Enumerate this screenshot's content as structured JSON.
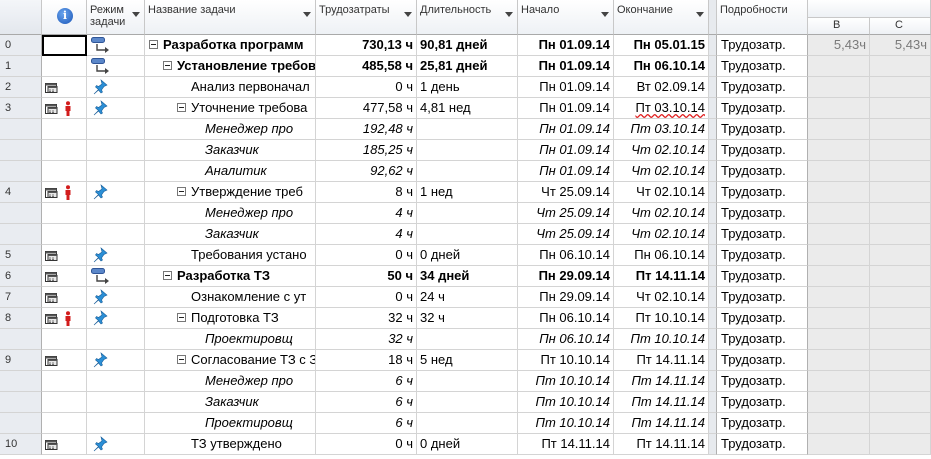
{
  "header": {
    "id": "",
    "indicators_icon": "info-icon",
    "mode": "Режим задачи",
    "name": "Название задачи",
    "work": "Трудозатраты",
    "duration": "Длительность",
    "start": "Начало",
    "finish": "Окончание",
    "details": "Подробности",
    "col_b": "B",
    "col_c": "C"
  },
  "rows": [
    {
      "id": "0",
      "ind": [],
      "mode": "auto",
      "name": "Разработка программ",
      "indent": 0,
      "toggle": true,
      "style": "bold",
      "work": "730,13 ч",
      "dur": "90,81 дней",
      "start": "Пн 01.09.14",
      "finish": "Пн 05.01.15",
      "det": "Трудозатр.",
      "b": "5,43ч",
      "cc": "5,43ч",
      "selected": true
    },
    {
      "id": "1",
      "ind": [],
      "mode": "auto",
      "name": "Установление требов",
      "indent": 1,
      "toggle": true,
      "style": "bold",
      "work": "485,58 ч",
      "dur": "25,81 дней",
      "start": "Пн 01.09.14",
      "finish": "Пн 06.10.14",
      "det": "Трудозатр.",
      "b": "",
      "cc": ""
    },
    {
      "id": "2",
      "ind": [
        "cal"
      ],
      "mode": "pin",
      "name": "Анализ первоначал",
      "indent": 3,
      "toggle": false,
      "style": "",
      "work": "0 ч",
      "dur": "1 день",
      "start": "Пн 01.09.14",
      "finish": "Вт 02.09.14",
      "det": "Трудозатр.",
      "b": "",
      "cc": ""
    },
    {
      "id": "3",
      "ind": [
        "cal",
        "res"
      ],
      "mode": "pin",
      "name": "Уточнение требова",
      "indent": 2,
      "toggle": true,
      "style": "",
      "work": "477,58 ч",
      "dur": "4,81 нед",
      "start": "Пн 01.09.14",
      "finish": "Пт 03.10.14",
      "det": "Трудозатр.",
      "b": "",
      "cc": "",
      "spell": true
    },
    {
      "id": "",
      "ind": [],
      "mode": "",
      "name": "Менеджер про",
      "indent": 4,
      "toggle": false,
      "style": "ital",
      "work": "192,48 ч",
      "dur": "",
      "start": "Пн 01.09.14",
      "finish": "Пт 03.10.14",
      "det": "Трудозатр.",
      "b": "",
      "cc": ""
    },
    {
      "id": "",
      "ind": [],
      "mode": "",
      "name": "Заказчик",
      "indent": 4,
      "toggle": false,
      "style": "ital",
      "work": "185,25 ч",
      "dur": "",
      "start": "Пн 01.09.14",
      "finish": "Чт 02.10.14",
      "det": "Трудозатр.",
      "b": "",
      "cc": ""
    },
    {
      "id": "",
      "ind": [],
      "mode": "",
      "name": "Аналитик",
      "indent": 4,
      "toggle": false,
      "style": "ital",
      "work": "92,62 ч",
      "dur": "",
      "start": "Пн 01.09.14",
      "finish": "Чт 02.10.14",
      "det": "Трудозатр.",
      "b": "",
      "cc": ""
    },
    {
      "id": "4",
      "ind": [
        "cal",
        "res"
      ],
      "mode": "pin",
      "name": "Утверждение треб",
      "indent": 2,
      "toggle": true,
      "style": "",
      "work": "8 ч",
      "dur": "1 нед",
      "start": "Чт 25.09.14",
      "finish": "Чт 02.10.14",
      "det": "Трудозатр.",
      "b": "",
      "cc": ""
    },
    {
      "id": "",
      "ind": [],
      "mode": "",
      "name": "Менеджер про",
      "indent": 4,
      "toggle": false,
      "style": "ital",
      "work": "4 ч",
      "dur": "",
      "start": "Чт 25.09.14",
      "finish": "Чт 02.10.14",
      "det": "Трудозатр.",
      "b": "",
      "cc": ""
    },
    {
      "id": "",
      "ind": [],
      "mode": "",
      "name": "Заказчик",
      "indent": 4,
      "toggle": false,
      "style": "ital",
      "work": "4 ч",
      "dur": "",
      "start": "Чт 25.09.14",
      "finish": "Чт 02.10.14",
      "det": "Трудозатр.",
      "b": "",
      "cc": ""
    },
    {
      "id": "5",
      "ind": [
        "cal"
      ],
      "mode": "pin",
      "name": "Требования устано",
      "indent": 3,
      "toggle": false,
      "style": "",
      "work": "0 ч",
      "dur": "0 дней",
      "start": "Пн 06.10.14",
      "finish": "Пн 06.10.14",
      "det": "Трудозатр.",
      "b": "",
      "cc": ""
    },
    {
      "id": "6",
      "ind": [
        "cal"
      ],
      "mode": "auto",
      "name": "Разработка ТЗ",
      "indent": 1,
      "toggle": true,
      "style": "bold",
      "work": "50 ч",
      "dur": "34 дней",
      "start": "Пн 29.09.14",
      "finish": "Пт 14.11.14",
      "det": "Трудозатр.",
      "b": "",
      "cc": ""
    },
    {
      "id": "7",
      "ind": [
        "cal"
      ],
      "mode": "pin",
      "name": "Ознакомление с ут",
      "indent": 3,
      "toggle": false,
      "style": "",
      "work": "0 ч",
      "dur": "24 ч",
      "start": "Пн 29.09.14",
      "finish": "Чт 02.10.14",
      "det": "Трудозатр.",
      "b": "",
      "cc": ""
    },
    {
      "id": "8",
      "ind": [
        "cal",
        "res"
      ],
      "mode": "pin",
      "name": "Подготовка ТЗ",
      "indent": 2,
      "toggle": true,
      "style": "",
      "work": "32 ч",
      "dur": "32 ч",
      "start": "Пн 06.10.14",
      "finish": "Пт 10.10.14",
      "det": "Трудозатр.",
      "b": "",
      "cc": ""
    },
    {
      "id": "",
      "ind": [],
      "mode": "",
      "name": "Проектировщ",
      "indent": 4,
      "toggle": false,
      "style": "ital",
      "work": "32 ч",
      "dur": "",
      "start": "Пн 06.10.14",
      "finish": "Пт 10.10.14",
      "det": "Трудозатр.",
      "b": "",
      "cc": ""
    },
    {
      "id": "9",
      "ind": [
        "cal"
      ],
      "mode": "pin",
      "name": "Согласование ТЗ с З",
      "indent": 2,
      "toggle": true,
      "style": "",
      "work": "18 ч",
      "dur": "5 нед",
      "start": "Пт 10.10.14",
      "finish": "Пт 14.11.14",
      "det": "Трудозатр.",
      "b": "",
      "cc": ""
    },
    {
      "id": "",
      "ind": [],
      "mode": "",
      "name": "Менеджер про",
      "indent": 4,
      "toggle": false,
      "style": "ital",
      "work": "6 ч",
      "dur": "",
      "start": "Пт 10.10.14",
      "finish": "Пт 14.11.14",
      "det": "Трудозатр.",
      "b": "",
      "cc": ""
    },
    {
      "id": "",
      "ind": [],
      "mode": "",
      "name": "Заказчик",
      "indent": 4,
      "toggle": false,
      "style": "ital",
      "work": "6 ч",
      "dur": "",
      "start": "Пт 10.10.14",
      "finish": "Пт 14.11.14",
      "det": "Трудозатр.",
      "b": "",
      "cc": ""
    },
    {
      "id": "",
      "ind": [],
      "mode": "",
      "name": "Проектировщ",
      "indent": 4,
      "toggle": false,
      "style": "ital",
      "work": "6 ч",
      "dur": "",
      "start": "Пт 10.10.14",
      "finish": "Пт 14.11.14",
      "det": "Трудозатр.",
      "b": "",
      "cc": ""
    },
    {
      "id": "10",
      "ind": [
        "cal"
      ],
      "mode": "pin",
      "name": "ТЗ утверждено",
      "indent": 3,
      "toggle": false,
      "style": "",
      "work": "0 ч",
      "dur": "0 дней",
      "start": "Пт 14.11.14",
      "finish": "Пт 14.11.14",
      "det": "Трудозатр.",
      "b": "",
      "cc": ""
    }
  ]
}
